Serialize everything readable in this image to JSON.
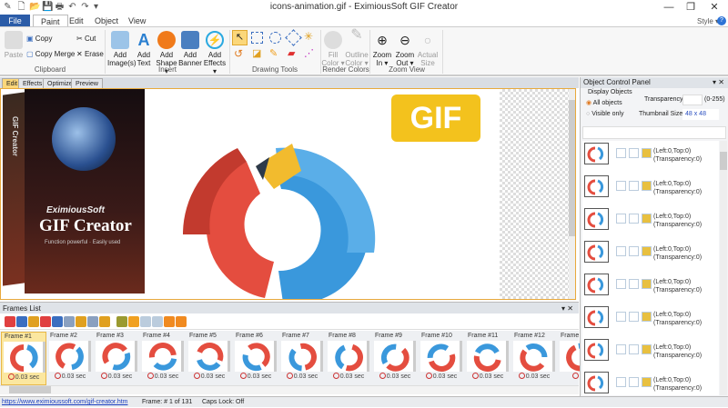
{
  "window": {
    "title": "icons-animation.gif - EximiousSoft GIF Creator",
    "minimize": "—",
    "restore": "❐",
    "close": "✕"
  },
  "quick_access": [
    "✎",
    "🗋",
    "📂",
    "💾",
    "🖶",
    "↶",
    "↷",
    "▾"
  ],
  "ribbon_tabs": [
    "File",
    "Paint",
    "Edit",
    "Object",
    "View"
  ],
  "style_label": "Style ▾",
  "help": "?",
  "clipboard": {
    "paste": "Paste",
    "copy": "Copy",
    "copy_merge": "Copy Merge",
    "cut": "Cut",
    "erase": "Erase",
    "group": "Clipboard"
  },
  "insert": {
    "items": [
      {
        "l1": "Add",
        "l2": "Image(s)"
      },
      {
        "l1": "Add",
        "l2": "Text"
      },
      {
        "l1": "Add",
        "l2": "Shape ▾"
      },
      {
        "l1": "Add",
        "l2": "Banner"
      },
      {
        "l1": "Add",
        "l2": "Effects ▾"
      }
    ],
    "group": "Insert"
  },
  "drawing_tools": {
    "group": "Drawing Tools"
  },
  "render_colors": {
    "items": [
      {
        "l1": "Fill",
        "l2": "Color ▾"
      },
      {
        "l1": "Outline",
        "l2": "Color ▾"
      }
    ],
    "group": "Render Colors"
  },
  "zoom_view": {
    "items": [
      {
        "l1": "Zoom",
        "l2": "In ▾"
      },
      {
        "l1": "Zoom",
        "l2": "Out ▾"
      },
      {
        "l1": "Actual",
        "l2": "Size"
      }
    ],
    "group": "Zoom View"
  },
  "edit_tabs": [
    "Edit",
    "Effects",
    "Optimize",
    "Preview"
  ],
  "canvas": {
    "badge": "GIF",
    "box_brand": "EximiousSoft",
    "box_title": "GIF Creator",
    "box_side": "GIF Creator",
    "box_tagline": "Function powerful · Easily used"
  },
  "frames_list": {
    "title": "Frames List",
    "frames": [
      {
        "label": "Frame #1",
        "delay": "0.03 sec"
      },
      {
        "label": "Frame #2",
        "delay": "0.03 sec"
      },
      {
        "label": "Frame #3",
        "delay": "0.03 sec"
      },
      {
        "label": "Frame #4",
        "delay": "0.03 sec"
      },
      {
        "label": "Frame #5",
        "delay": "0.03 sec"
      },
      {
        "label": "Frame #6",
        "delay": "0.03 sec"
      },
      {
        "label": "Frame #7",
        "delay": "0.03 sec"
      },
      {
        "label": "Frame #8",
        "delay": "0.03 sec"
      },
      {
        "label": "Frame #9",
        "delay": "0.03 sec"
      },
      {
        "label": "Frame #10",
        "delay": "0.03 sec"
      },
      {
        "label": "Frame #11",
        "delay": "0.03 sec"
      },
      {
        "label": "Frame #12",
        "delay": "0.03 sec"
      },
      {
        "label": "Frame #",
        "delay": "0.0"
      }
    ]
  },
  "object_panel": {
    "title": "Object Control Panel",
    "display_objects": "Display Objects",
    "all_objects": "All objects",
    "visible_only": "Visible only",
    "transparency_label": "Transparency:",
    "transparency_value": "",
    "transparency_range": "(0-255)",
    "thumb_label": "Thumbnail Size:",
    "thumb_value": "48 x 48",
    "rows": [
      {
        "l1": "(Left:0,Top:0)",
        "l2": "(Transparency:0)"
      },
      {
        "l1": "(Left:0,Top:0)",
        "l2": "(Transparency:0)"
      },
      {
        "l1": "(Left:0,Top:0)",
        "l2": "(Transparency:0)"
      },
      {
        "l1": "(Left:0,Top:0)",
        "l2": "(Transparency:0)"
      },
      {
        "l1": "(Left:0,Top:0)",
        "l2": "(Transparency:0)"
      },
      {
        "l1": "(Left:0,Top:0)",
        "l2": "(Transparency:0)"
      },
      {
        "l1": "(Left:0,Top:0)",
        "l2": "(Transparency:0)"
      },
      {
        "l1": "(Left:0,Top:0)",
        "l2": "(Transparency:0)"
      }
    ]
  },
  "status": {
    "link": "https://www.eximioussoft.com/gif-creator.htm",
    "frame": "Frame: # 1 of 131",
    "caps": "Caps Lock: Off"
  }
}
